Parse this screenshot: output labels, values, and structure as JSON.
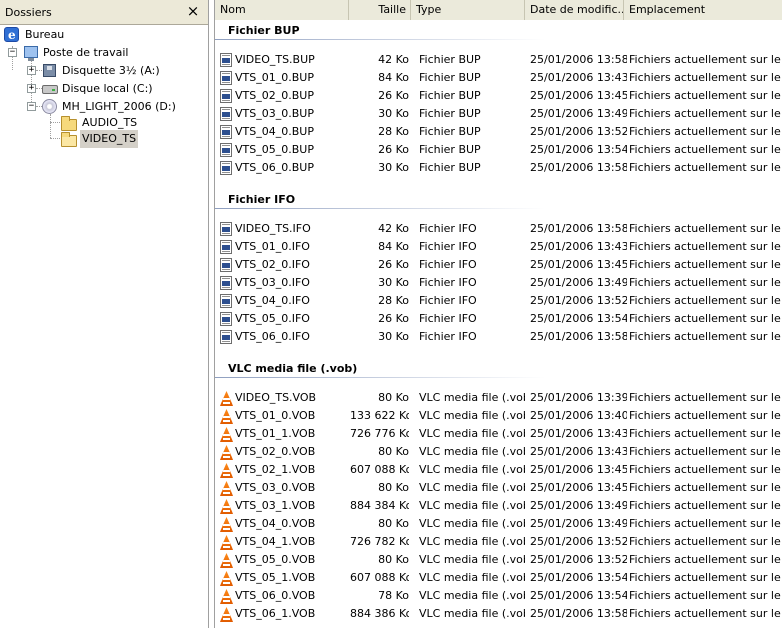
{
  "folders_pane": {
    "title": "Dossiers",
    "close_glyph": "×",
    "tree": [
      {
        "label": "Bureau",
        "icon": "desktop-icon"
      },
      {
        "label": "Poste de travail",
        "icon": "computer-icon",
        "expander": "−"
      },
      {
        "label": "Disquette 3½ (A:)",
        "icon": "floppy-icon",
        "expander": "+"
      },
      {
        "label": "Disque local (C:)",
        "icon": "hard-disk-icon",
        "expander": "+"
      },
      {
        "label": "MH_LIGHT_2006 (D:)",
        "icon": "cd-icon",
        "expander": "−"
      },
      {
        "label": "AUDIO_TS",
        "icon": "folder-icon"
      },
      {
        "label": "VIDEO_TS",
        "icon": "folder-open-icon",
        "selected": true
      }
    ]
  },
  "list_pane": {
    "columns": [
      "Nom",
      "Taille",
      "Type",
      "Date de modific...",
      "Emplacement"
    ],
    "groups": [
      {
        "title": "Fichier BUP",
        "icon": "document-icon",
        "rows": [
          {
            "name": "VIDEO_TS.BUP",
            "size": "42 Ko",
            "type": "Fichier BUP",
            "date": "25/01/2006 13:58",
            "location": "Fichiers actuellement sur le CD"
          },
          {
            "name": "VTS_01_0.BUP",
            "size": "84 Ko",
            "type": "Fichier BUP",
            "date": "25/01/2006 13:43",
            "location": "Fichiers actuellement sur le CD"
          },
          {
            "name": "VTS_02_0.BUP",
            "size": "26 Ko",
            "type": "Fichier BUP",
            "date": "25/01/2006 13:45",
            "location": "Fichiers actuellement sur le CD"
          },
          {
            "name": "VTS_03_0.BUP",
            "size": "30 Ko",
            "type": "Fichier BUP",
            "date": "25/01/2006 13:49",
            "location": "Fichiers actuellement sur le CD"
          },
          {
            "name": "VTS_04_0.BUP",
            "size": "28 Ko",
            "type": "Fichier BUP",
            "date": "25/01/2006 13:52",
            "location": "Fichiers actuellement sur le CD"
          },
          {
            "name": "VTS_05_0.BUP",
            "size": "26 Ko",
            "type": "Fichier BUP",
            "date": "25/01/2006 13:54",
            "location": "Fichiers actuellement sur le CD"
          },
          {
            "name": "VTS_06_0.BUP",
            "size": "30 Ko",
            "type": "Fichier BUP",
            "date": "25/01/2006 13:58",
            "location": "Fichiers actuellement sur le CD"
          }
        ]
      },
      {
        "title": "Fichier IFO",
        "icon": "document-icon",
        "rows": [
          {
            "name": "VIDEO_TS.IFO",
            "size": "42 Ko",
            "type": "Fichier IFO",
            "date": "25/01/2006 13:58",
            "location": "Fichiers actuellement sur le CD"
          },
          {
            "name": "VTS_01_0.IFO",
            "size": "84 Ko",
            "type": "Fichier IFO",
            "date": "25/01/2006 13:43",
            "location": "Fichiers actuellement sur le CD"
          },
          {
            "name": "VTS_02_0.IFO",
            "size": "26 Ko",
            "type": "Fichier IFO",
            "date": "25/01/2006 13:45",
            "location": "Fichiers actuellement sur le CD"
          },
          {
            "name": "VTS_03_0.IFO",
            "size": "30 Ko",
            "type": "Fichier IFO",
            "date": "25/01/2006 13:49",
            "location": "Fichiers actuellement sur le CD"
          },
          {
            "name": "VTS_04_0.IFO",
            "size": "28 Ko",
            "type": "Fichier IFO",
            "date": "25/01/2006 13:52",
            "location": "Fichiers actuellement sur le CD"
          },
          {
            "name": "VTS_05_0.IFO",
            "size": "26 Ko",
            "type": "Fichier IFO",
            "date": "25/01/2006 13:54",
            "location": "Fichiers actuellement sur le CD"
          },
          {
            "name": "VTS_06_0.IFO",
            "size": "30 Ko",
            "type": "Fichier IFO",
            "date": "25/01/2006 13:58",
            "location": "Fichiers actuellement sur le CD"
          }
        ]
      },
      {
        "title": "VLC media file (.vob)",
        "icon": "vlc-cone-icon",
        "rows": [
          {
            "name": "VIDEO_TS.VOB",
            "size": "80 Ko",
            "type": "VLC media file (.vob)",
            "date": "25/01/2006 13:39",
            "location": "Fichiers actuellement sur le CD"
          },
          {
            "name": "VTS_01_0.VOB",
            "size": "133 622 Ko",
            "type": "VLC media file (.vob)",
            "date": "25/01/2006 13:40",
            "location": "Fichiers actuellement sur le CD"
          },
          {
            "name": "VTS_01_1.VOB",
            "size": "726 776 Ko",
            "type": "VLC media file (.vob)",
            "date": "25/01/2006 13:43",
            "location": "Fichiers actuellement sur le CD"
          },
          {
            "name": "VTS_02_0.VOB",
            "size": "80 Ko",
            "type": "VLC media file (.vob)",
            "date": "25/01/2006 13:43",
            "location": "Fichiers actuellement sur le CD"
          },
          {
            "name": "VTS_02_1.VOB",
            "size": "607 088 Ko",
            "type": "VLC media file (.vob)",
            "date": "25/01/2006 13:45",
            "location": "Fichiers actuellement sur le CD"
          },
          {
            "name": "VTS_03_0.VOB",
            "size": "80 Ko",
            "type": "VLC media file (.vob)",
            "date": "25/01/2006 13:45",
            "location": "Fichiers actuellement sur le CD"
          },
          {
            "name": "VTS_03_1.VOB",
            "size": "884 384 Ko",
            "type": "VLC media file (.vob)",
            "date": "25/01/2006 13:49",
            "location": "Fichiers actuellement sur le CD"
          },
          {
            "name": "VTS_04_0.VOB",
            "size": "80 Ko",
            "type": "VLC media file (.vob)",
            "date": "25/01/2006 13:49",
            "location": "Fichiers actuellement sur le CD"
          },
          {
            "name": "VTS_04_1.VOB",
            "size": "726 782 Ko",
            "type": "VLC media file (.vob)",
            "date": "25/01/2006 13:52",
            "location": "Fichiers actuellement sur le CD"
          },
          {
            "name": "VTS_05_0.VOB",
            "size": "80 Ko",
            "type": "VLC media file (.vob)",
            "date": "25/01/2006 13:52",
            "location": "Fichiers actuellement sur le CD"
          },
          {
            "name": "VTS_05_1.VOB",
            "size": "607 088 Ko",
            "type": "VLC media file (.vob)",
            "date": "25/01/2006 13:54",
            "location": "Fichiers actuellement sur le CD"
          },
          {
            "name": "VTS_06_0.VOB",
            "size": "78 Ko",
            "type": "VLC media file (.vob)",
            "date": "25/01/2006 13:54",
            "location": "Fichiers actuellement sur le CD"
          },
          {
            "name": "VTS_06_1.VOB",
            "size": "884 386 Ko",
            "type": "VLC media file (.vob)",
            "date": "25/01/2006 13:58",
            "location": "Fichiers actuellement sur le CD"
          }
        ]
      }
    ]
  },
  "colors": {
    "header_bg": "#ebeadb",
    "selection_bg": "#d4d0c8",
    "group_line": "#8f9fc0",
    "vlc_orange": "#ff8c1a"
  }
}
